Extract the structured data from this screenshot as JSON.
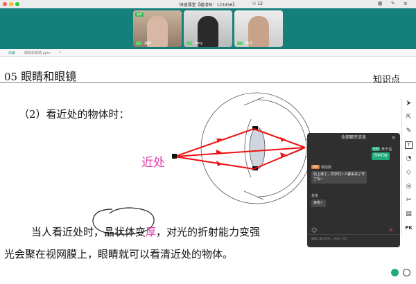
{
  "window": {
    "title": "快速课堂【邀请码：123456】",
    "user_count": "12"
  },
  "participants": [
    {
      "name": "海莉",
      "tag": "老师"
    },
    {
      "name": "Amy",
      "tag": ""
    },
    {
      "name": "杨洋",
      "tag": ""
    }
  ],
  "tabs": {
    "left": "白板",
    "doc": "眼睛和眼镜.pptx",
    "add": "+"
  },
  "slide": {
    "number": "05",
    "title": "眼睛和眼镜",
    "corner": "知识点",
    "subtitle": "（2）看近处的物体时：",
    "near_label": "近处",
    "body_line1_a": "当人看近处时，",
    "body_line1_b": "晶状体变",
    "body_line1_pink": "厚",
    "body_line1_c": "，对光的折射能力变强",
    "body_line2": "光会聚在视网膜上，眼睛就可以看清近处的物体。"
  },
  "chat": {
    "header": "全部聊天信息",
    "messages": [
      {
        "badge": "老师",
        "name": "吴千语",
        "text": "同学们好"
      },
      {
        "badge": "助教",
        "name": "杨勋数",
        "text_l1": "快上课了，同学们~人都来来了齐",
        "text_l2": "了吗~"
      },
      {
        "badge": "",
        "name": "金金",
        "text": "来啦！"
      }
    ],
    "input_placeholder": "随输入聊天信息，所有人可见"
  },
  "toolbar": {
    "items": [
      "pointer-icon",
      "select-icon",
      "pen-icon",
      "text-icon",
      "shape-icon",
      "eraser-icon",
      "settings-icon",
      "scissors-icon",
      "toolbox-icon",
      "pk-icon"
    ],
    "pk_label": "PK"
  },
  "colors": {
    "videobar": "#147f7b",
    "accent_pink": "#e23fae",
    "ray_red": "#ee1111",
    "chat_green": "#1fa97c"
  }
}
